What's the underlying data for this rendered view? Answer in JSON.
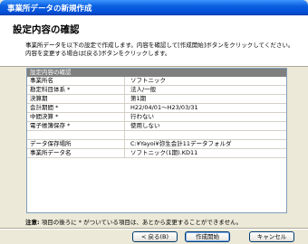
{
  "window": {
    "title": "事業所データの新規作成"
  },
  "header": {
    "heading": "設定内容の確認",
    "desc_line1": "事業所データを以下の設定で作成します。内容を確認して[作成開始]ボタンをクリックしてください。",
    "desc_line2": "内容を変更する場合は[戻る]ボタンをクリックします。"
  },
  "table": {
    "header": "設定内容の確認",
    "rows": [
      {
        "key": "事業所名",
        "value": "ソフトニック"
      },
      {
        "key": "勘定科目体系 *",
        "value": "法人/一般"
      },
      {
        "key": "決算期",
        "value": "第1期"
      },
      {
        "key": "会計期間 *",
        "value": "H22/04/01～H23/03/31"
      },
      {
        "key": "中間決算 *",
        "value": "行わない"
      },
      {
        "key": "電子帳簿保存 *",
        "value": "使用しない"
      },
      {
        "key": "",
        "value": ""
      },
      {
        "key": "データ保存場所",
        "value": "C:¥Yayoi¥弥生会計11データフォルダ"
      },
      {
        "key": "事業所データ名",
        "value": "ソフトニック(1期).KD11"
      }
    ]
  },
  "note": {
    "label": "注意:",
    "text": "項目の後ろに * がついている項目は、あとから変更することができません。"
  },
  "buttons": {
    "back": "< 戻る(B)",
    "start": "作成開始",
    "cancel": "キャンセル"
  }
}
